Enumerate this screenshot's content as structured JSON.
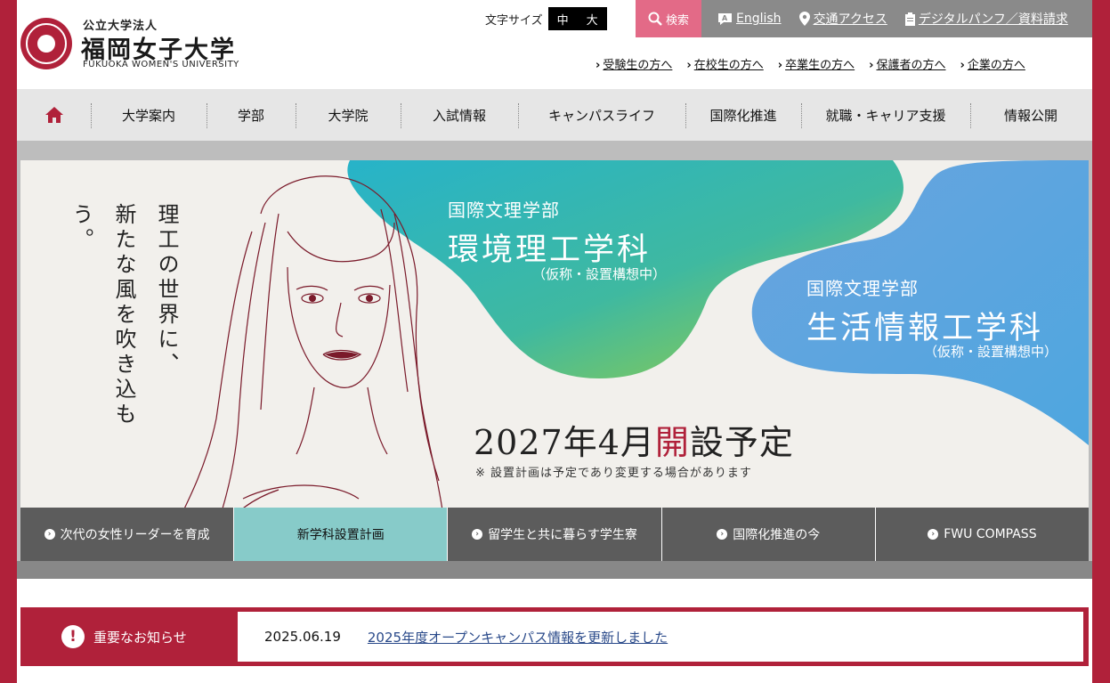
{
  "header": {
    "logo_sub": "公立大学法人",
    "logo_name": "福岡女子大学",
    "logo_en": "FUKUOKA WOMEN'S UNIVERSITY",
    "font_size_label": "文字サイズ",
    "font_size_options": [
      "中",
      "大"
    ],
    "search_label": "検索",
    "utility_links": [
      "English",
      "交通アクセス",
      "デジタルパンフ／資料請求"
    ],
    "audience_links": [
      "受験生の方へ",
      "在校生の方へ",
      "卒業生の方へ",
      "保護者の方へ",
      "企業の方へ"
    ]
  },
  "nav": {
    "items": [
      "大学案内",
      "学部",
      "大学院",
      "入試情報",
      "キャンパスライフ",
      "国際化推進",
      "就職・キャリア支援",
      "情報公開"
    ]
  },
  "hero": {
    "tagline": "理工の世界に、\n新たな風を吹き込もう。",
    "dept1": {
      "faculty": "国際文理学部",
      "name": "環境理工学科",
      "note": "（仮称・設置構想中）"
    },
    "dept2": {
      "faculty": "国際文理学部",
      "name": "生活情報工学科",
      "note": "（仮称・設置構想中）"
    },
    "opening_pre": "2027年4月",
    "opening_accent": "開",
    "opening_post": "設予定",
    "note": "※ 設置計画は予定であり変更する場合があります"
  },
  "tabs": [
    {
      "label": "次代の女性リーダーを育成",
      "active": false
    },
    {
      "label": "新学科設置計画",
      "active": true
    },
    {
      "label": "留学生と共に暮らす学生寮",
      "active": false
    },
    {
      "label": "国際化推進の今",
      "active": false
    },
    {
      "label": "FWU COMPASS",
      "active": false
    }
  ],
  "notice": {
    "label": "重要なお知らせ",
    "date": "2025.06.19",
    "text": "2025年度オープンキャンパス情報を更新しました"
  },
  "colors": {
    "brand": "#b0213a",
    "search": "#e36a87",
    "tab_active": "#87cbc9"
  }
}
